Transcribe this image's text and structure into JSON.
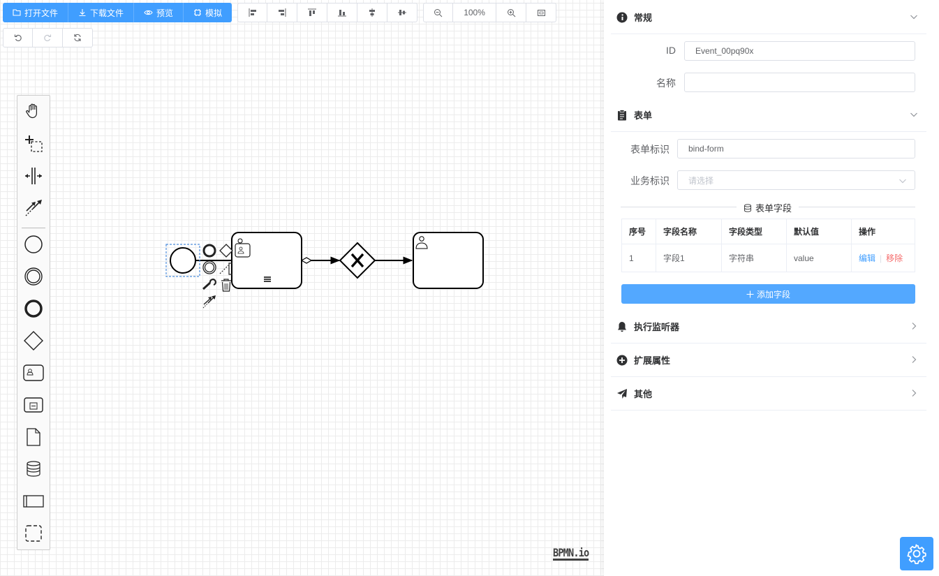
{
  "toolbar": {
    "open_label": "打开文件",
    "download_label": "下载文件",
    "preview_label": "预览",
    "simulate_label": "模拟",
    "zoom": "100%"
  },
  "palette": {
    "tools": [
      "hand-tool-icon",
      "lasso-tool-icon",
      "space-tool-icon",
      "global-connect-icon"
    ],
    "shapes": [
      "start-event-icon",
      "intermediate-event-icon",
      "end-event-icon",
      "gateway-icon",
      "user-task-icon",
      "subprocess-icon",
      "data-object-icon",
      "data-store-icon",
      "participant-icon",
      "group-icon"
    ]
  },
  "brand": {
    "logo": "BPMN.io"
  },
  "panel": {
    "general": {
      "title": "常规",
      "id_label": "ID",
      "id_value": "Event_00pq90x",
      "name_label": "名称",
      "name_value": ""
    },
    "form": {
      "title": "表单",
      "key_label": "表单标识",
      "key_value": "bind-form",
      "business_label": "业务标识",
      "business_placeholder": "请选择",
      "fields_title": "表单字段",
      "columns": [
        "序号",
        "字段名称",
        "字段类型",
        "默认值",
        "操作"
      ],
      "rows": [
        {
          "index": "1",
          "name": "字段1",
          "type": "字符串",
          "default": "value",
          "edit": "编辑",
          "remove": "移除"
        }
      ],
      "add_label": "添加字段"
    },
    "listeners": {
      "title": "执行监听器"
    },
    "extensions": {
      "title": "扩展属性"
    },
    "other": {
      "title": "其他"
    }
  },
  "colors": {
    "primary": "#409eff",
    "danger": "#f56c6c"
  }
}
